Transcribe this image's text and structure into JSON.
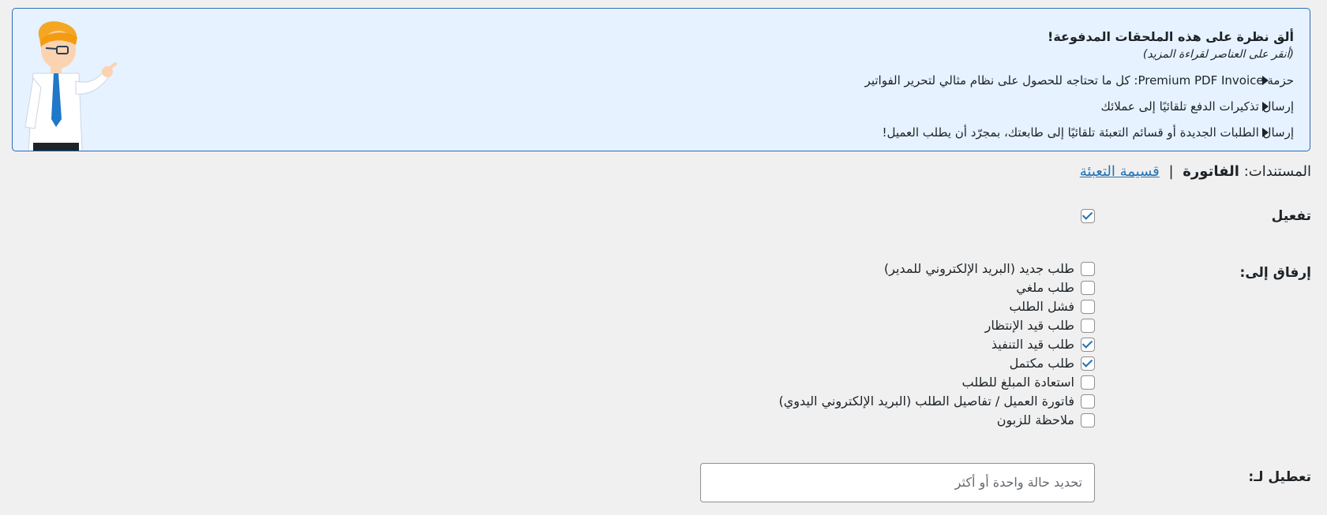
{
  "promo": {
    "title": "ألق نظرة على هذه الملحقات المدفوعة!",
    "subtitle": "(أنقر على العناصر لقراءة المزيد)",
    "items": [
      {
        "text": "حزمة Premium PDF Invoice: كل ما تحتاجه للحصول على نظام مثالي لتحرير الفواتير"
      },
      {
        "text": "إرسال تذكيرات الدفع تلقائيًا إلى عملائك"
      },
      {
        "text": "إرسال الطلبات الجديدة أو قسائم التعبئة تلقائيًا إلى طابعتك، بمجرّد أن يطلب العميل!"
      }
    ]
  },
  "documents": {
    "label": "المستندات:",
    "current": "الفاتورة",
    "separator": "|",
    "other_link": "قسيمة التعبئة"
  },
  "settings": {
    "enable": {
      "label": "تفعيل",
      "checked": true
    },
    "attach_to": {
      "label": "إرفاق إلى:",
      "options": [
        {
          "label": "طلب جديد (البريد الإلكتروني للمدير)",
          "checked": false
        },
        {
          "label": "طلب ملغي",
          "checked": false
        },
        {
          "label": "فشل الطلب",
          "checked": false
        },
        {
          "label": "طلب قيد الإنتظار",
          "checked": false
        },
        {
          "label": "طلب قيد التنفيذ",
          "checked": true
        },
        {
          "label": "طلب مكتمل",
          "checked": true
        },
        {
          "label": "استعادة المبلغ للطلب",
          "checked": false
        },
        {
          "label": "فاتورة العميل / تفاصيل الطلب (البريد الإلكتروني اليدوي)",
          "checked": false
        },
        {
          "label": "ملاحظة للزبون",
          "checked": false
        }
      ]
    },
    "disable_for": {
      "label": "تعطيل لـ:",
      "placeholder": "تحديد حالة واحدة أو أكثر"
    }
  },
  "colors": {
    "banner_bg": "#e6f2ff",
    "banner_border": "#2a6bb8",
    "link": "#2271b1",
    "checkmark": "#2271b1"
  },
  "icons": {
    "mascot": "cartoon-man-pointing",
    "promo_bullet": "triangle-right-icon"
  }
}
